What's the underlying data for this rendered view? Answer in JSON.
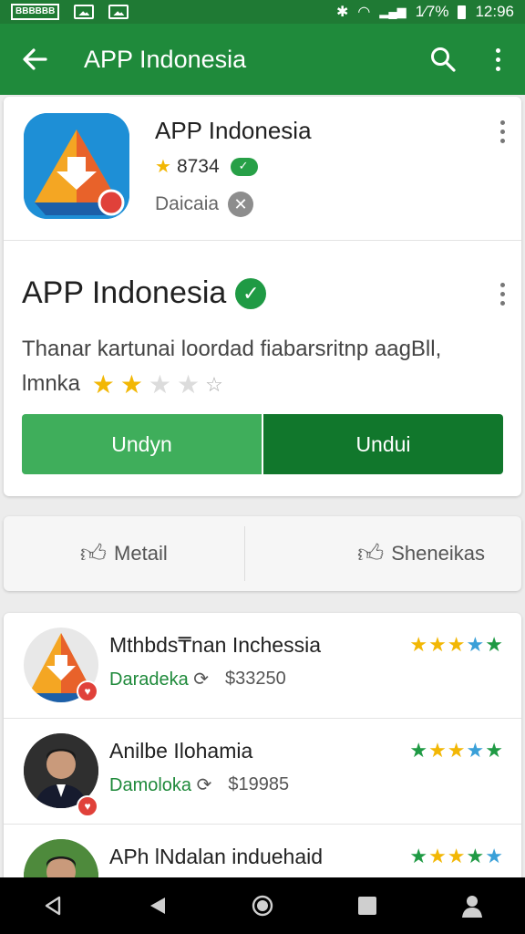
{
  "status_bar": {
    "badge_text": "BBBBBB",
    "bt_icon": "✱",
    "wifi_icon": "◠",
    "signal_icon": "▂▄▆",
    "battery_text": "1⁄7%",
    "time": "12:96"
  },
  "app_bar": {
    "title": "APP Indonesia",
    "back_icon": "arrow-left-icon",
    "search_icon": "search-icon",
    "more_icon": "more-vert-icon",
    "color": "#1f8a3b"
  },
  "header": {
    "title": "APP Indonesia",
    "rating": "8734",
    "subtitle": "Daicaia"
  },
  "body": {
    "title": "APP Indonesia",
    "description": "Thanar kartunai loordad fiabarsritnp aagBll,",
    "description_line2": "lmnka",
    "rating_stars": 2,
    "button_left": "Undyn",
    "button_right": "Undui"
  },
  "actions": {
    "left_label": "Metail",
    "right_label": "Sheneikas"
  },
  "list": [
    {
      "name": "Mthbds₸nan Inchessia",
      "download_label": "Daradeka",
      "count": "$33250",
      "stars": 5
    },
    {
      "name": "Anilbe Ilohamia",
      "download_label": "Damoloka",
      "count": "$19985",
      "stars": 5
    },
    {
      "name": "APh lNdalan induehaid",
      "download_label": "",
      "count": "",
      "stars": 5
    }
  ],
  "colors": {
    "primary": "#1f8a3b",
    "dark_button": "#11772c",
    "light_button": "#3fae5b",
    "star_gold": "#f2b705",
    "star_green": "#1f9a44",
    "star_blue": "#3aa0d8"
  }
}
